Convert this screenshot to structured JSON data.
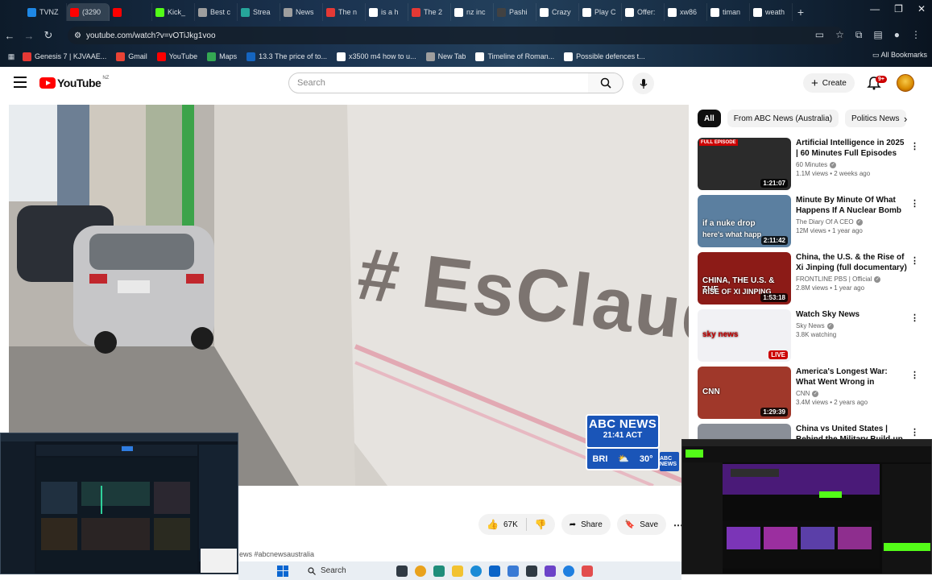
{
  "browser": {
    "tabs": [
      {
        "label": "TVNZ",
        "icon": "tvnz-icon",
        "color": "#1e88e5"
      },
      {
        "label": "(3290",
        "icon": "youtube-icon",
        "color": "#ff0000"
      },
      {
        "label": "",
        "icon": "youtube-icon",
        "color": "#ff0000"
      },
      {
        "label": "Kick_",
        "icon": "kick-icon",
        "color": "#53fc18"
      },
      {
        "label": "Best c",
        "icon": "page-icon",
        "color": "#9e9e9e"
      },
      {
        "label": "Strea",
        "icon": "stream-icon",
        "color": "#26a69a"
      },
      {
        "label": "News",
        "icon": "page-icon",
        "color": "#9e9e9e"
      },
      {
        "label": "The n",
        "icon": "red-icon",
        "color": "#e53935"
      },
      {
        "label": "is a h",
        "icon": "google-icon",
        "color": "#ffffff"
      },
      {
        "label": "The 2",
        "icon": "red-icon",
        "color": "#e53935"
      },
      {
        "label": "nz inc",
        "icon": "google-icon",
        "color": "#ffffff"
      },
      {
        "label": "Pashi",
        "icon": "page-icon",
        "color": "#424242"
      },
      {
        "label": "Crazy",
        "icon": "page-icon",
        "color": "#ffffff"
      },
      {
        "label": "Play C",
        "icon": "page-icon",
        "color": "#ffffff"
      },
      {
        "label": "Offer:",
        "icon": "page-icon",
        "color": "#ffffff"
      },
      {
        "label": "xw86",
        "icon": "google-icon",
        "color": "#ffffff"
      },
      {
        "label": "timan",
        "icon": "google-icon",
        "color": "#ffffff"
      },
      {
        "label": "weath",
        "icon": "google-icon",
        "color": "#ffffff"
      }
    ],
    "url": "youtube.com/watch?v=vOTiJkg1voo",
    "bookmarks": [
      {
        "label": "Genesis 7 | KJVAAE...",
        "color": "#e53935"
      },
      {
        "label": "Gmail",
        "color": "#ea4335"
      },
      {
        "label": "YouTube",
        "color": "#ff0000"
      },
      {
        "label": "Maps",
        "color": "#34a853"
      },
      {
        "label": "13.3 The price of to...",
        "color": "#1565c0"
      },
      {
        "label": "x3500 m4 how to u...",
        "color": "#ffffff"
      },
      {
        "label": "New Tab",
        "color": "#9e9e9e"
      },
      {
        "label": "Timeline of Roman...",
        "color": "#ffffff"
      },
      {
        "label": "Possible defences t...",
        "color": "#ffffff"
      }
    ],
    "all_bookmarks": "All Bookmarks"
  },
  "youtube": {
    "logo": "YouTube",
    "region": "NZ",
    "search_placeholder": "Search",
    "create": "Create",
    "notifications": "9+",
    "chips": [
      "All",
      "From ABC News (Australia)",
      "Politics News"
    ],
    "player": {
      "wall_text": "# EsClaudia",
      "bug_title": "ABC NEWS",
      "bug_time": "21:41 ACT",
      "bug_city": "BRI",
      "bug_temp": "30°",
      "bug_small": "ABC NEWS"
    },
    "actions": {
      "likes": "67K",
      "share": "Share",
      "save": "Save"
    },
    "hashtag": "ews #abcnewsaustralia",
    "recommendations": [
      {
        "title": "Artificial Intelligence in 2025 | 60 Minutes Full Episodes",
        "channel": "60 Minutes",
        "verified": true,
        "stats": "1.1M views • 2 weeks ago",
        "duration": "1:21:07",
        "badge": "FULL EPISODE",
        "thumb": "#2b2b2b"
      },
      {
        "title": "Minute By Minute Of What Happens If A Nuclear Bomb ...",
        "channel": "The Diary Of A CEO",
        "verified": true,
        "stats": "12M views • 1 year ago",
        "duration": "2:11:42",
        "badge": "",
        "thumb": "#5b7fa0",
        "caption": "if a nuke drop",
        "caption2": "here's what happ"
      },
      {
        "title": "China, the U.S. & the Rise of Xi Jinping (full documentary) | ...",
        "channel": "FRONTLINE PBS | Official",
        "verified": true,
        "stats": "2.8M views • 1 year ago",
        "duration": "1:53:18",
        "badge": "",
        "thumb": "#8c1b17",
        "caption": "CHINA, THE U.S. & THE",
        "caption2": "RISE OF XI JINPING"
      },
      {
        "title": "Watch Sky News",
        "channel": "Sky News",
        "verified": true,
        "stats": "3.8K watching",
        "duration": "LIVE",
        "badge": "",
        "thumb": "#f1f1f4",
        "caption": "sky news"
      },
      {
        "title": "America's Longest War: What Went Wrong in Afghanistan ...",
        "channel": "CNN",
        "verified": true,
        "stats": "3.4M views • 2 years ago",
        "duration": "1:29:39",
        "badge": "",
        "thumb": "#a0382a",
        "caption": "CNN"
      },
      {
        "title": "China vs United States | Behind the Military Build-up",
        "channel": "",
        "verified": false,
        "stats": "",
        "duration": "",
        "badge": "",
        "thumb": "#8a8f98"
      }
    ]
  },
  "taskbar": {
    "search": "Search"
  },
  "colors": {
    "youtube_red": "#ff0000",
    "abc_blue": "#1a55b8",
    "chip_selected": "#0f0f0f"
  }
}
